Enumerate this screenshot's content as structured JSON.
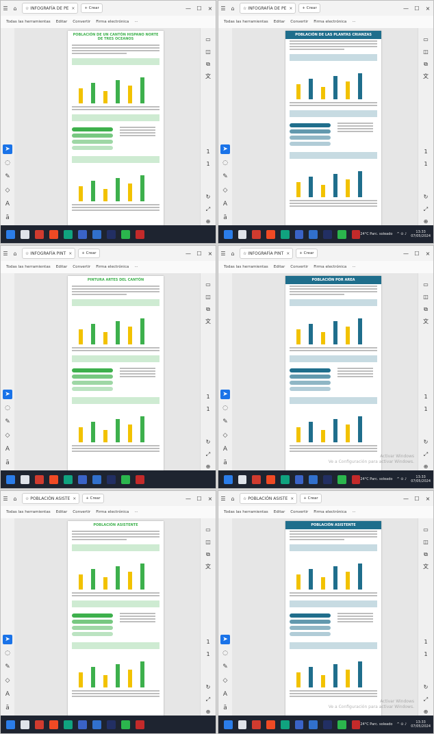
{
  "menu": {
    "all_tools": "Todas las herramientas",
    "edit": "Editar",
    "convert": "Convertir",
    "esign": "Firma electrónica",
    "more": "···"
  },
  "new_tab": "+ Crear",
  "panes": [
    {
      "tab": "INFOGRAFÍA DE PE",
      "doc_title": "POBLACIÓN DE UN CANTÓN HISPANO NORTE DE TRES OCEANOS",
      "theme": "light",
      "accent": "#3db04c"
    },
    {
      "tab": "INFOGRAFÍA DE PE",
      "doc_title": "POBLACIÓN DE LAS PLANTAS CRIANZAS",
      "theme": "dark",
      "accent": "#1f6e8c"
    },
    {
      "tab": "INFOGRAFÍA PINT",
      "doc_title": "PINTURA ARTES DEL CANTÓN",
      "theme": "light",
      "accent": "#3db04c"
    },
    {
      "tab": "INFOGRAFÍA PINT",
      "doc_title": "POBLACIÓN POR AREA",
      "theme": "dark",
      "accent": "#1f6e8c"
    },
    {
      "tab": "POBLACIÓN ASISTE",
      "doc_title": "POBLACIÓN ASISTENTE",
      "theme": "light",
      "accent": "#3db04c"
    },
    {
      "tab": "POBLACIÓN ASISTE",
      "doc_title": "POBLACIÓN ASISTENTE",
      "theme": "dark",
      "accent": "#1f6e8c"
    }
  ],
  "tray": {
    "weather": "24°C Parc. soleado",
    "time": "13:33",
    "date": "07/05/2024"
  },
  "watermark": {
    "line1": "Activar Windows",
    "line2": "Ve a Configuración para activar Windows."
  }
}
